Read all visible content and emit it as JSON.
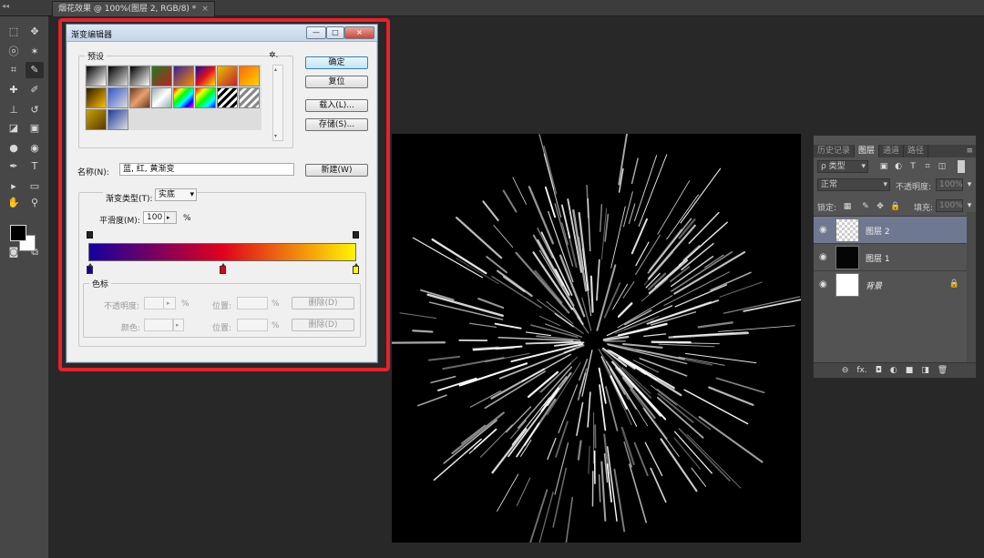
{
  "document": {
    "tab_title": "烟花效果 @ 100%(图层 2, RGB/8) *",
    "tab_close": "×",
    "collapse_arrows": "◂◂"
  },
  "toolbox": {
    "tools": [
      {
        "name": "marquee-tool-icon",
        "glyph": "⬚"
      },
      {
        "name": "move-tool-icon",
        "glyph": "✥"
      },
      {
        "name": "lasso-tool-icon",
        "glyph": "ⓞ"
      },
      {
        "name": "magic-wand-tool-icon",
        "glyph": "✶"
      },
      {
        "name": "crop-tool-icon",
        "glyph": "⌗"
      },
      {
        "name": "eyedropper-tool-icon",
        "glyph": "✎"
      },
      {
        "name": "healing-brush-tool-icon",
        "glyph": "✚"
      },
      {
        "name": "brush-tool-icon",
        "glyph": "✐"
      },
      {
        "name": "clone-stamp-tool-icon",
        "glyph": "⊥"
      },
      {
        "name": "history-brush-tool-icon",
        "glyph": "↺"
      },
      {
        "name": "eraser-tool-icon",
        "glyph": "◪"
      },
      {
        "name": "gradient-tool-icon",
        "glyph": "▣"
      },
      {
        "name": "blur-tool-icon",
        "glyph": "●"
      },
      {
        "name": "dodge-tool-icon",
        "glyph": "◉"
      },
      {
        "name": "pen-tool-icon",
        "glyph": "✒"
      },
      {
        "name": "type-tool-icon",
        "glyph": "T"
      },
      {
        "name": "path-select-tool-icon",
        "glyph": "▸"
      },
      {
        "name": "shape-tool-icon",
        "glyph": "▭"
      },
      {
        "name": "hand-tool-icon",
        "glyph": "✋"
      },
      {
        "name": "zoom-tool-icon",
        "glyph": "⚲"
      },
      {
        "name": "quick-mask-icon",
        "glyph": "◙"
      },
      {
        "name": "screen-mode-icon",
        "glyph": "⧉"
      }
    ],
    "foreground_color": "#000000",
    "background_color": "#ffffff"
  },
  "dialog": {
    "title": "渐变编辑器",
    "win_min": "—",
    "win_max": "□",
    "win_close": "×",
    "presets_legend": "预设",
    "gear": "✲.",
    "buttons": {
      "ok": "确定",
      "reset": "复位",
      "load": "载入(L)...",
      "save": "存储(S)...",
      "new": "新建(W)"
    },
    "name_label": "名称(N):",
    "name_value": "蓝, 红, 黄渐变",
    "gradient_type_label": "渐变类型(T):",
    "gradient_type_value": "实底",
    "smoothness_label": "平滑度(M):",
    "smoothness_value": "100",
    "smoothness_unit": "%",
    "stops_legend": "色标",
    "opacity_label": "不透明度:",
    "opacity_unit": "%",
    "location_label": "位置:",
    "location_unit": "%",
    "color_label": "颜色:",
    "delete_label": "删除(D)",
    "gradient_colors": [
      "#1400a0",
      "#e0001c",
      "#fff400"
    ]
  },
  "layers_panel": {
    "tabs": [
      "历史记录",
      "图层",
      "通道",
      "路径"
    ],
    "active_tab": "图层",
    "filter_label": "ρ 类型",
    "blend_mode": "正常",
    "opacity_label": "不透明度:",
    "opacity_value": "100%",
    "lock_label": "锁定:",
    "fill_label": "填充:",
    "fill_value": "100%",
    "layers": [
      {
        "name": "图层 2",
        "active": true
      },
      {
        "name": "图层 1",
        "active": false
      },
      {
        "name": "背景",
        "active": false
      }
    ],
    "footer_icons": [
      "⊖",
      "fx.",
      "◘",
      "◐",
      "■",
      "◨",
      "🗑"
    ]
  },
  "highlight_color": "#e8212a"
}
